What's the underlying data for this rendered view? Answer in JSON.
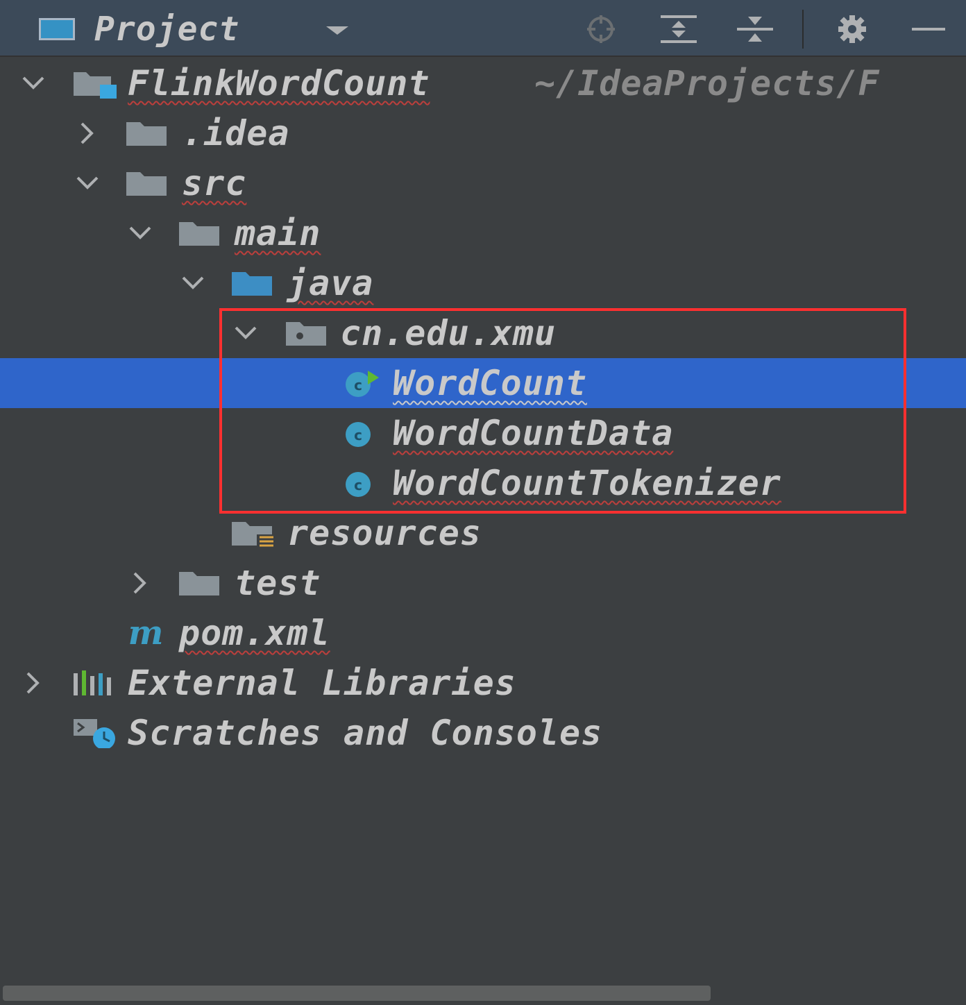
{
  "toolbar": {
    "title": "Project",
    "icons": [
      "locate-icon",
      "expand-all-icon",
      "collapse-all-icon",
      "gear-icon",
      "minimize-icon"
    ]
  },
  "tree": {
    "root": {
      "label": "FlinkWordCount",
      "path": "~/IdeaProjects/F"
    },
    "idea": {
      "label": ".idea"
    },
    "src": {
      "label": "src"
    },
    "main": {
      "label": "main"
    },
    "java": {
      "label": "java"
    },
    "package": {
      "label": "cn.edu.xmu"
    },
    "wordcount": {
      "label": "WordCount"
    },
    "wordcountdata": {
      "label": "WordCountData"
    },
    "wordcounttokenizer": {
      "label": "WordCountTokenizer"
    },
    "resources": {
      "label": "resources"
    },
    "test": {
      "label": "test"
    },
    "pom": {
      "label": "pom.xml"
    },
    "external": {
      "label": "External Libraries"
    },
    "scratches": {
      "label": "Scratches and Consoles"
    }
  },
  "colors": {
    "toolbar_bg": "#3c4a59",
    "panel_bg": "#3c3f41",
    "selection": "#2f65ca",
    "annotation_box": "#ff3030",
    "class_icon": "#3d9ec4"
  }
}
